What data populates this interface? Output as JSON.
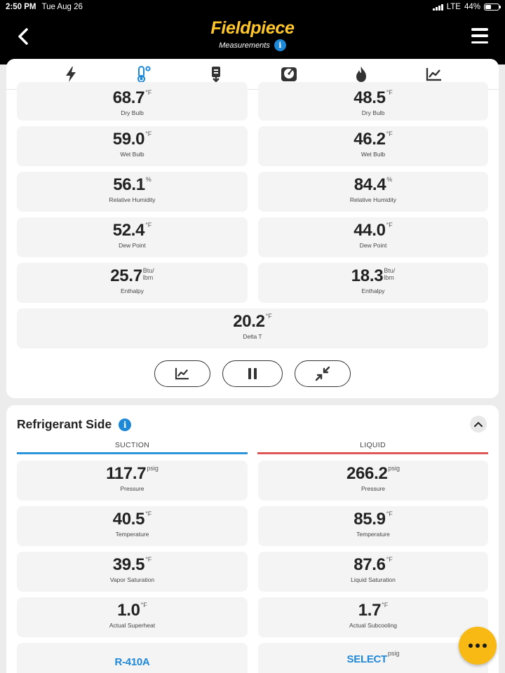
{
  "status_bar": {
    "time": "2:50 PM",
    "date": "Tue Aug 26",
    "network": "LTE",
    "battery": "44%",
    "battery_level": 0.44
  },
  "header": {
    "brand": "Fieldpiece",
    "subtitle": "Measurements",
    "info": "i"
  },
  "tabs": [
    {
      "icon": "lightning-icon"
    },
    {
      "icon": "thermometer-icon",
      "active": true
    },
    {
      "icon": "probe-icon"
    },
    {
      "icon": "gauge-icon"
    },
    {
      "icon": "flame-icon"
    },
    {
      "icon": "chart-icon"
    }
  ],
  "air_side": {
    "left": [
      {
        "value": "68.7",
        "unit": "°F",
        "label": "Dry Bulb"
      },
      {
        "value": "59.0",
        "unit": "°F",
        "label": "Wet Bulb"
      },
      {
        "value": "56.1",
        "unit": "%",
        "label": "Relative Humidity"
      },
      {
        "value": "52.4",
        "unit": "°F",
        "label": "Dew Point"
      },
      {
        "value": "25.7",
        "unit": "Btu/",
        "unit2": "lbm",
        "label": "Enthalpy"
      }
    ],
    "right": [
      {
        "value": "48.5",
        "unit": "°F",
        "label": "Dry Bulb"
      },
      {
        "value": "46.2",
        "unit": "°F",
        "label": "Wet Bulb"
      },
      {
        "value": "84.4",
        "unit": "%",
        "label": "Relative Humidity"
      },
      {
        "value": "44.0",
        "unit": "°F",
        "label": "Dew Point"
      },
      {
        "value": "18.3",
        "unit": "Btu/",
        "unit2": "lbm",
        "label": "Enthalpy"
      }
    ],
    "delta": {
      "value": "20.2",
      "unit": "°F",
      "label": "Delta T"
    }
  },
  "refrigerant": {
    "title": "Refrigerant Side",
    "suction_label": "SUCTION",
    "liquid_label": "LIQUID",
    "suction": [
      {
        "value": "117.7",
        "unit": "psig",
        "label": "Pressure"
      },
      {
        "value": "40.5",
        "unit": "°F",
        "label": "Temperature"
      },
      {
        "value": "39.5",
        "unit": "°F",
        "label": "Vapor Saturation"
      },
      {
        "value": "1.0",
        "unit": "°F",
        "label": "Actual Superheat"
      },
      {
        "value": "R-410A"
      }
    ],
    "liquid": [
      {
        "value": "266.2",
        "unit": "psig",
        "label": "Pressure"
      },
      {
        "value": "85.9",
        "unit": "°F",
        "label": "Temperature"
      },
      {
        "value": "87.6",
        "unit": "°F",
        "label": "Liquid Saturation"
      },
      {
        "value": "1.7",
        "unit": "°F",
        "label": "Actual Subcooling"
      },
      {
        "value": "SELECT",
        "unit": "psig"
      }
    ]
  },
  "colors": {
    "brand": "#ffc629",
    "accent": "#1e88d8",
    "suction": "#2b93d9",
    "liquid": "#e05555",
    "fab": "#f8b915"
  }
}
